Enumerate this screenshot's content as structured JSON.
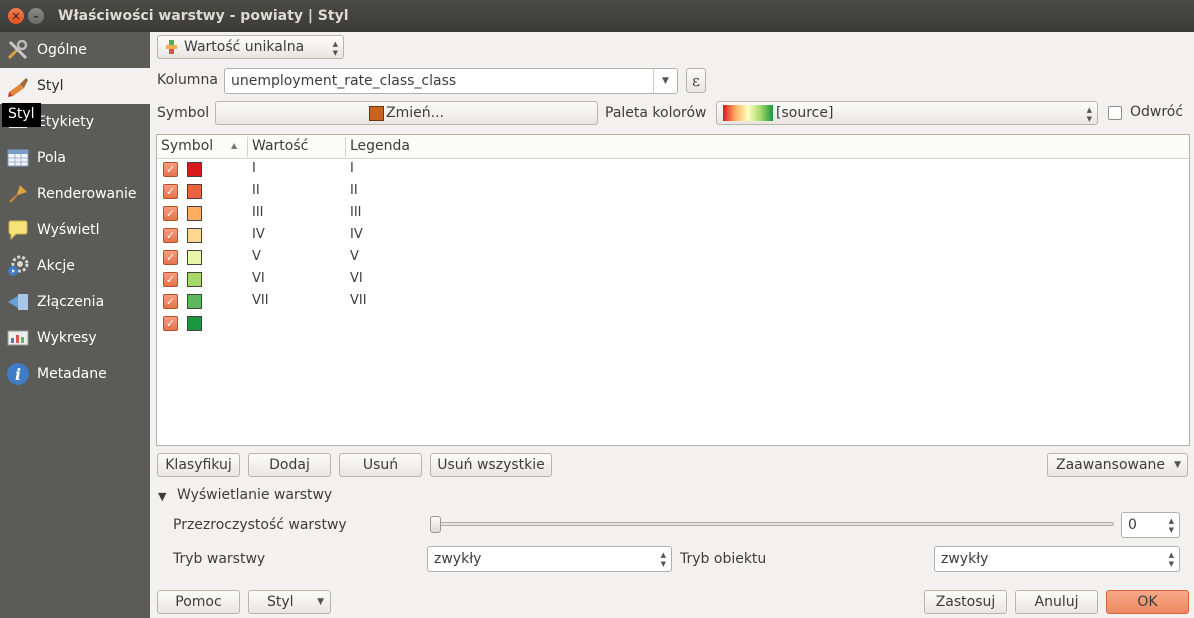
{
  "window": {
    "title": "Właściwości warstwy - powiaty | Styl"
  },
  "sidebar": {
    "items": [
      {
        "label": "Ogólne",
        "icon": "tools-icon"
      },
      {
        "label": "Styl",
        "icon": "paintbrush-icon"
      },
      {
        "label": "Etykiety",
        "icon": "label-icon"
      },
      {
        "label": "Pola",
        "icon": "table-icon"
      },
      {
        "label": "Renderowanie",
        "icon": "brush-icon"
      },
      {
        "label": "Wyświetl",
        "icon": "speech-bubble-icon"
      },
      {
        "label": "Akcje",
        "icon": "gear-icon"
      },
      {
        "label": "Złączenia",
        "icon": "join-icon"
      },
      {
        "label": "Wykresy",
        "icon": "chart-icon"
      },
      {
        "label": "Metadane",
        "icon": "info-icon"
      }
    ],
    "tooltip": "Styl"
  },
  "renderer": {
    "type": "Wartość unikalna"
  },
  "column": {
    "label": "Kolumna",
    "value": "unemployment_rate_class_class",
    "expr_symbol": "ε"
  },
  "symbol": {
    "label": "Symbol",
    "button": "Zmień...",
    "color": "#c8641e"
  },
  "ramp": {
    "label": "Paleta kolorów",
    "value": "[source]",
    "invert_label": "Odwróć",
    "invert_checked": false
  },
  "table": {
    "headers": {
      "symbol": "Symbol",
      "value": "Wartość",
      "legend": "Legenda"
    },
    "rows": [
      {
        "checked": true,
        "color": "#d7191c",
        "value": "I",
        "legend": "I"
      },
      {
        "checked": true,
        "color": "#ea633e",
        "value": "II",
        "legend": "II"
      },
      {
        "checked": true,
        "color": "#fdae61",
        "value": "III",
        "legend": "III"
      },
      {
        "checked": true,
        "color": "#fed690",
        "value": "IV",
        "legend": "IV"
      },
      {
        "checked": true,
        "color": "#e6f5a8",
        "value": "V",
        "legend": "V"
      },
      {
        "checked": true,
        "color": "#a6d96a",
        "value": "VI",
        "legend": "VI"
      },
      {
        "checked": true,
        "color": "#5cb85c",
        "value": "VII",
        "legend": "VII"
      },
      {
        "checked": true,
        "color": "#1a9641",
        "value": "",
        "legend": ""
      }
    ]
  },
  "actions": {
    "classify": "Klasyfikuj",
    "add": "Dodaj",
    "remove": "Usuń",
    "remove_all": "Usuń wszystkie",
    "advanced": "Zaawansowane"
  },
  "layer_render": {
    "section": "Wyświetlanie warstwy",
    "transparency_label": "Przezroczystość warstwy",
    "transparency_value": "0",
    "blend_label": "Tryb warstwy",
    "blend_value": "zwykły",
    "feature_blend_label": "Tryb obiektu",
    "feature_blend_value": "zwykły"
  },
  "footer": {
    "help": "Pomoc",
    "style": "Styl",
    "apply": "Zastosuj",
    "cancel": "Anuluj",
    "ok": "OK"
  },
  "colors": {
    "accent": "#f29b72",
    "sidebar": "#5b5b58",
    "titlebar": "#3b3b39"
  }
}
